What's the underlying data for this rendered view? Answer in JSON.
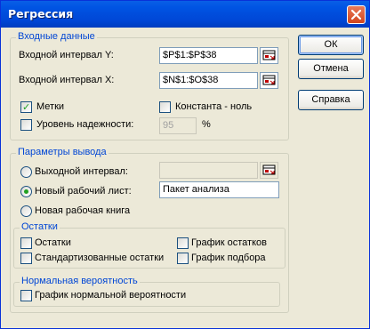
{
  "window": {
    "title": "Регрессия"
  },
  "input_group": {
    "label": "Входные данные",
    "input_y_label": "Входной интервал Y:",
    "input_y_value": "$P$1:$P$38",
    "input_x_label": "Входной интервал X:",
    "input_x_value": "$N$1:$O$38",
    "labels_checkbox": {
      "label": "Метки",
      "checked": true
    },
    "constant_zero_checkbox": {
      "label": "Константа - ноль",
      "checked": false
    },
    "confidence_checkbox": {
      "label": "Уровень надежности:",
      "checked": false
    },
    "confidence_value": "95",
    "confidence_unit": "%"
  },
  "output_group": {
    "label": "Параметры вывода",
    "output_range_radio": {
      "label": "Выходной интервал:",
      "selected": false
    },
    "output_range_value": "",
    "new_sheet_radio": {
      "label": "Новый рабочий лист:",
      "selected": true
    },
    "new_sheet_value": "Пакет анализа",
    "new_workbook_radio": {
      "label": "Новая рабочая книга",
      "selected": false
    }
  },
  "residuals_group": {
    "label": "Остатки",
    "residuals": {
      "label": "Остатки",
      "checked": false
    },
    "standardized_residuals": {
      "label": "Стандартизованные остатки",
      "checked": false
    },
    "residual_plots": {
      "label": "График остатков",
      "checked": false
    },
    "line_fit_plots": {
      "label": "График подбора",
      "checked": false
    }
  },
  "normal_group": {
    "label": "Нормальная вероятность",
    "normal_plot": {
      "label": "График нормальной вероятности",
      "checked": false
    }
  },
  "buttons": {
    "ok": "ОК",
    "cancel": "Отмена",
    "help": "Справка"
  }
}
